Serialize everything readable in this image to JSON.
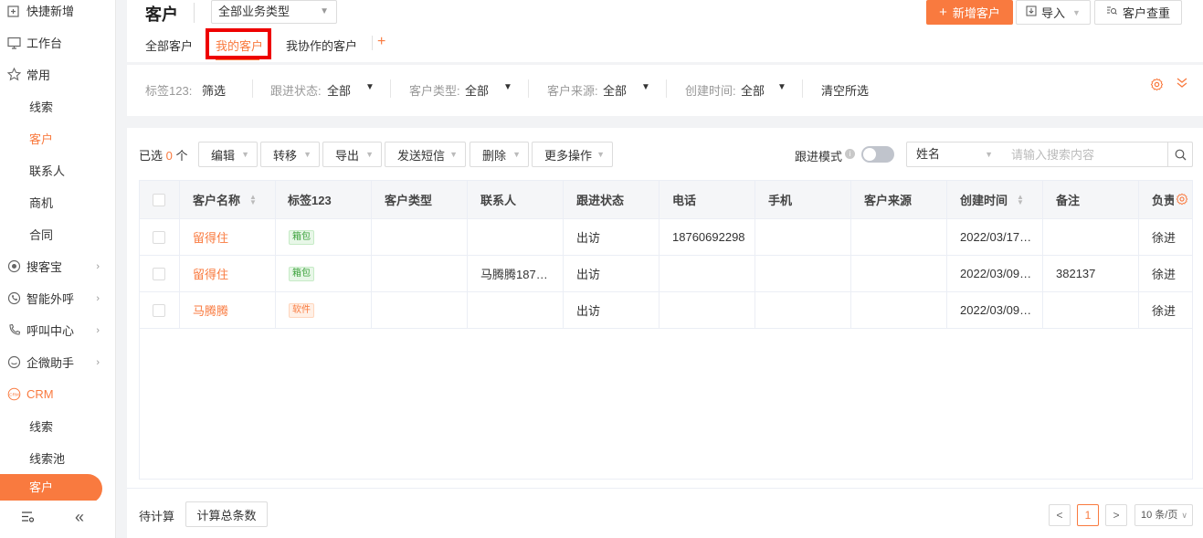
{
  "sidebar": {
    "quick_new": "快捷新增",
    "workbench": "工作台",
    "common": "常用",
    "common_items": [
      "线索",
      "客户",
      "联系人",
      "商机",
      "合同"
    ],
    "soukebao": "搜客宝",
    "smart_call": "智能外呼",
    "call_center": "呼叫中心",
    "wecom_assistant": "企微助手",
    "crm": "CRM",
    "crm_items": [
      "线索",
      "线索池",
      "客户"
    ]
  },
  "header": {
    "title": "客户",
    "biz_type": "全部业务类型",
    "tabs": [
      "全部客户",
      "我的客户",
      "我协作的客户"
    ],
    "tab_add": "+",
    "new_customer": "新增客户",
    "import": "导入",
    "dedupe": "客户查重"
  },
  "filters": {
    "tag_label": "标签123:",
    "tag_value": "筛选",
    "follow_label": "跟进状态:",
    "follow_value": "全部",
    "type_label": "客户类型:",
    "type_value": "全部",
    "source_label": "客户来源:",
    "source_value": "全部",
    "created_label": "创建时间:",
    "created_value": "全部",
    "clear": "清空所选"
  },
  "toolbar": {
    "selected_prefix": "已选",
    "selected_count": "0",
    "selected_suffix": "个",
    "buttons": [
      "编辑",
      "转移",
      "导出",
      "发送短信",
      "删除",
      "更多操作"
    ],
    "follow_mode": "跟进模式",
    "search_field": "姓名",
    "search_placeholder": "请输入搜索内容"
  },
  "table": {
    "columns": [
      "客户名称",
      "标签123",
      "客户类型",
      "联系人",
      "跟进状态",
      "电话",
      "手机",
      "客户来源",
      "创建时间",
      "备注",
      "负责"
    ],
    "rows": [
      {
        "name": "留得住",
        "tag": "箱包",
        "tag_color": "green",
        "type": "",
        "contact": "",
        "follow": "出访",
        "phone": "18760692298",
        "mobile": "",
        "source": "",
        "created": "2022/03/17…",
        "remark": "",
        "owner": "徐进"
      },
      {
        "name": "留得住",
        "tag": "箱包",
        "tag_color": "green",
        "type": "",
        "contact": "马腾腾187…",
        "follow": "出访",
        "phone": "",
        "mobile": "",
        "source": "",
        "created": "2022/03/09…",
        "remark": "382137",
        "owner": "徐进"
      },
      {
        "name": "马腾腾",
        "tag": "软件",
        "tag_color": "orange",
        "type": "",
        "contact": "",
        "follow": "出访",
        "phone": "",
        "mobile": "",
        "source": "",
        "created": "2022/03/09…",
        "remark": "",
        "owner": "徐进"
      }
    ]
  },
  "footer": {
    "pending": "待计算",
    "calc_total": "计算总条数",
    "prev": "<",
    "page": "1",
    "next": ">",
    "page_size": "10 条/页"
  },
  "colors": {
    "accent": "#f97a3f",
    "highlight_box": "#ee0000"
  }
}
